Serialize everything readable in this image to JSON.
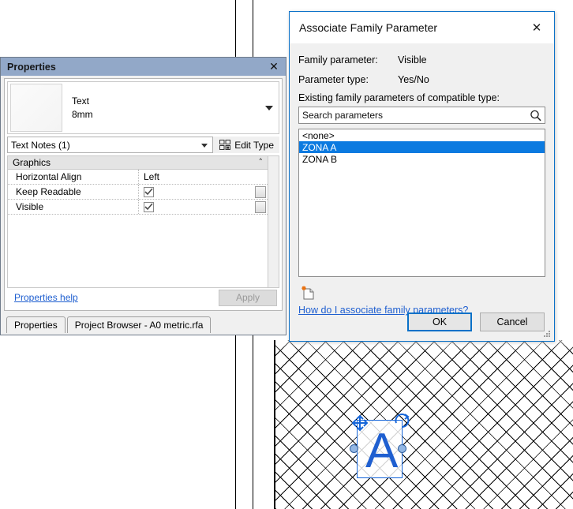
{
  "canvas": {
    "selected_text": "A",
    "hatch_pattern": "crosshatch-diagonal"
  },
  "properties_palette": {
    "title": "Properties",
    "close_icon": "✕",
    "type_preview": {
      "family": "Text",
      "type": "8mm",
      "dropdown_icon": "caret-down"
    },
    "selection_combo": {
      "value": "Text Notes (1)",
      "caret_icon": "caret-down"
    },
    "edit_type_label": "Edit Type",
    "edit_type_icon": "edit-type-icon",
    "group": {
      "name": "Graphics",
      "collapse_icon": "˄"
    },
    "rows": [
      {
        "name": "Horizontal Align",
        "value": "Left",
        "type": "text",
        "has_assoc": false
      },
      {
        "name": "Keep Readable",
        "value": "checked",
        "type": "checkbox",
        "has_assoc": true
      },
      {
        "name": "Visible",
        "value": "checked",
        "type": "checkbox",
        "has_assoc": true
      }
    ],
    "help_link": "Properties help",
    "apply_label": "Apply",
    "apply_enabled": false
  },
  "bottom_tabs": [
    {
      "label": "Properties",
      "active": false
    },
    {
      "label": "Project Browser - A0 metric.rfa",
      "active": true
    }
  ],
  "dialog": {
    "title": "Associate Family Parameter",
    "close_icon": "✕",
    "fields": [
      {
        "label": "Family parameter:",
        "value": "Visible"
      },
      {
        "label": "Parameter type:",
        "value": "Yes/No"
      }
    ],
    "list_label": "Existing family parameters of compatible type:",
    "search": {
      "value": "",
      "placeholder": "Search parameters",
      "icon": "search-icon"
    },
    "parameters": [
      {
        "label": "<none>",
        "selected": false
      },
      {
        "label": "ZONA A",
        "selected": true
      },
      {
        "label": "ZONA B",
        "selected": false
      }
    ],
    "new_parameter_icon": "new-parameter-icon",
    "help_link": "How do I associate family parameters?",
    "buttons": [
      {
        "label": "OK",
        "default": true
      },
      {
        "label": "Cancel",
        "default": false
      }
    ]
  },
  "colors": {
    "dialog_border": "#0a71c8",
    "selection_blue": "#0b7ae0",
    "palette_title": "#92a8c8",
    "link": "#1f5fd0",
    "cad_text": "#1f5fd0"
  }
}
